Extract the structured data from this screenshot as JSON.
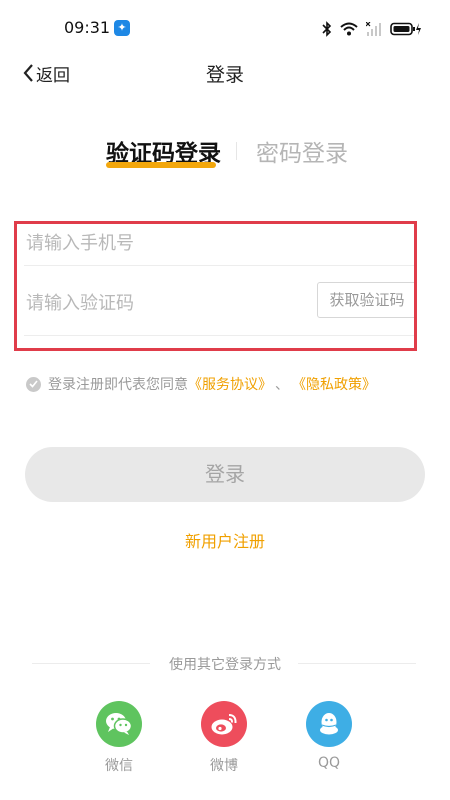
{
  "status_bar": {
    "time": "09:31"
  },
  "header": {
    "back_label": "返回",
    "title": "登录"
  },
  "tabs": [
    {
      "label": "验证码登录",
      "active": true
    },
    {
      "label": "密码登录",
      "active": false
    }
  ],
  "form": {
    "phone_placeholder": "请输入手机号",
    "phone_value": "",
    "code_placeholder": "请输入验证码",
    "code_value": "",
    "get_code_label": "获取验证码"
  },
  "agreement": {
    "text": "登录注册即代表您同意",
    "service_link": "《服务协议》",
    "separator": "、",
    "privacy_link": "《隐私政策》",
    "checked": false
  },
  "actions": {
    "login_label": "登录",
    "register_label": "新用户注册"
  },
  "other_login": {
    "title": "使用其它登录方式",
    "providers": [
      {
        "label": "微信",
        "icon": "wechat-icon",
        "color": "#5fc45f"
      },
      {
        "label": "微博",
        "icon": "weibo-icon",
        "color": "#ee4d5c"
      },
      {
        "label": "QQ",
        "icon": "qq-icon",
        "color": "#3eaee5"
      }
    ]
  },
  "colors": {
    "accent": "#f3a70c",
    "link": "#f0a000",
    "highlight_box": "#e03c4a"
  }
}
